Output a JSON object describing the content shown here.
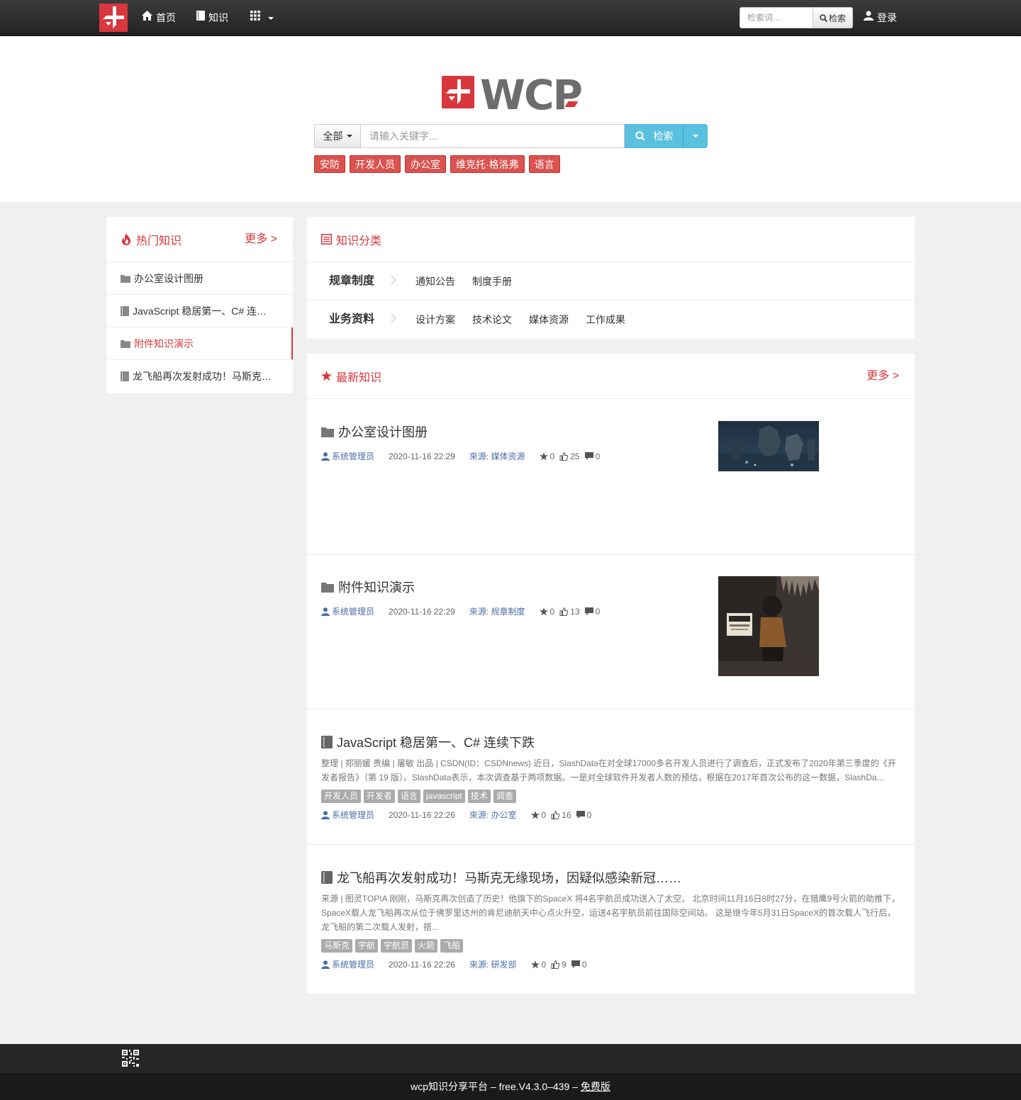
{
  "nav": {
    "home": "首页",
    "knowledge": "知识",
    "search_placeholder": "检索词...",
    "search_button": "检索",
    "login": "登录"
  },
  "hero": {
    "brand": "WCP",
    "scope": "全部",
    "search_placeholder": "请输入关键字...",
    "search_button": "检索",
    "tags": [
      "安防",
      "开发人员",
      "办公室",
      "维克托·格洛弗",
      "语言"
    ]
  },
  "hot": {
    "title": "热门知识",
    "more": "更多 >",
    "items": [
      {
        "label": "办公室设计图册",
        "icon": "folder-icon"
      },
      {
        "label": "JavaScript 稳居第一、C# 连续下跌",
        "icon": "book-icon"
      },
      {
        "label": "附件知识演示",
        "icon": "folder-icon"
      },
      {
        "label": "龙飞船再次发射成功！马斯克无缘现场，因疑似感染新冠……",
        "icon": "book-icon"
      }
    ]
  },
  "categories": {
    "title": "知识分类",
    "groups": [
      {
        "name": "规章制度",
        "links": [
          "通知公告",
          "制度手册"
        ]
      },
      {
        "name": "业务资料",
        "links": [
          "设计方案",
          "技术论文",
          "媒体资源",
          "工作成果"
        ]
      }
    ]
  },
  "latest": {
    "title": "最新知识",
    "more": "更多 >",
    "items": [
      {
        "title": "办公室设计图册",
        "author": "系统管理员",
        "time": "2020-11-16 22:29",
        "source": "來源: 媒体资源",
        "stars": "0",
        "views": "25",
        "comments": "0"
      },
      {
        "title": "附件知识演示",
        "author": "系统管理员",
        "time": "2020-11-16 22:29",
        "source": "來源: 规章制度",
        "stars": "0",
        "views": "13",
        "comments": "0"
      },
      {
        "title": "JavaScript 稳居第一、C# 连续下跌",
        "summary": "整理 | 郑丽媛 责编 | 屠敏 出品 | CSDN(ID：CSDNnews) 近日，SlashData在对全球17000多名开发人员进行了调查后，正式发布了2020年第三季度的《开发者报告》（第 19 版）。SlashData表示，本次调查基于两项数据。一是对全球软件开发者人数的预估，根据在2017年首次公布的这一数据，SlashDa...",
        "tags": [
          "开发人员",
          "开发者",
          "语言",
          "javascript",
          "技术",
          "调查"
        ],
        "author": "系统管理员",
        "time": "2020-11-16 22:26",
        "source": "來源: 办公室",
        "stars": "0",
        "views": "16",
        "comments": "0"
      },
      {
        "title": "龙飞船再次发射成功！马斯克无缘现场，因疑似感染新冠……",
        "summary": "来源 | 图灵TOPIA 刚刚，马斯克再次创造了历史！他旗下的SpaceX 将4名宇航员成功送入了太空。 北京时间11月16日8时27分，在猎鹰9号火箭的助推下，SpaceX载人龙飞船再次从位于佛罗里达州的肯尼迪航天中心点火升空，运送4名宇航员前往国际空间站。 这是继今年5月31日SpaceX的首次载人飞行后，龙飞船的第二次载人发射，搭...",
        "tags": [
          "马斯克",
          "宇航",
          "宇航员",
          "火箭",
          "飞船"
        ],
        "author": "系统管理员",
        "time": "2020-11-16 22:26",
        "source": "來源: 研发部",
        "stars": "0",
        "views": "9",
        "comments": "0"
      }
    ]
  },
  "footer": {
    "text": "wcp知识分享平台 – free.V4.3.0–439 –",
    "license": "免费版"
  },
  "colors": {
    "accent": "#d9363e",
    "info": "#5bc0de",
    "link": "#4a6da7"
  }
}
